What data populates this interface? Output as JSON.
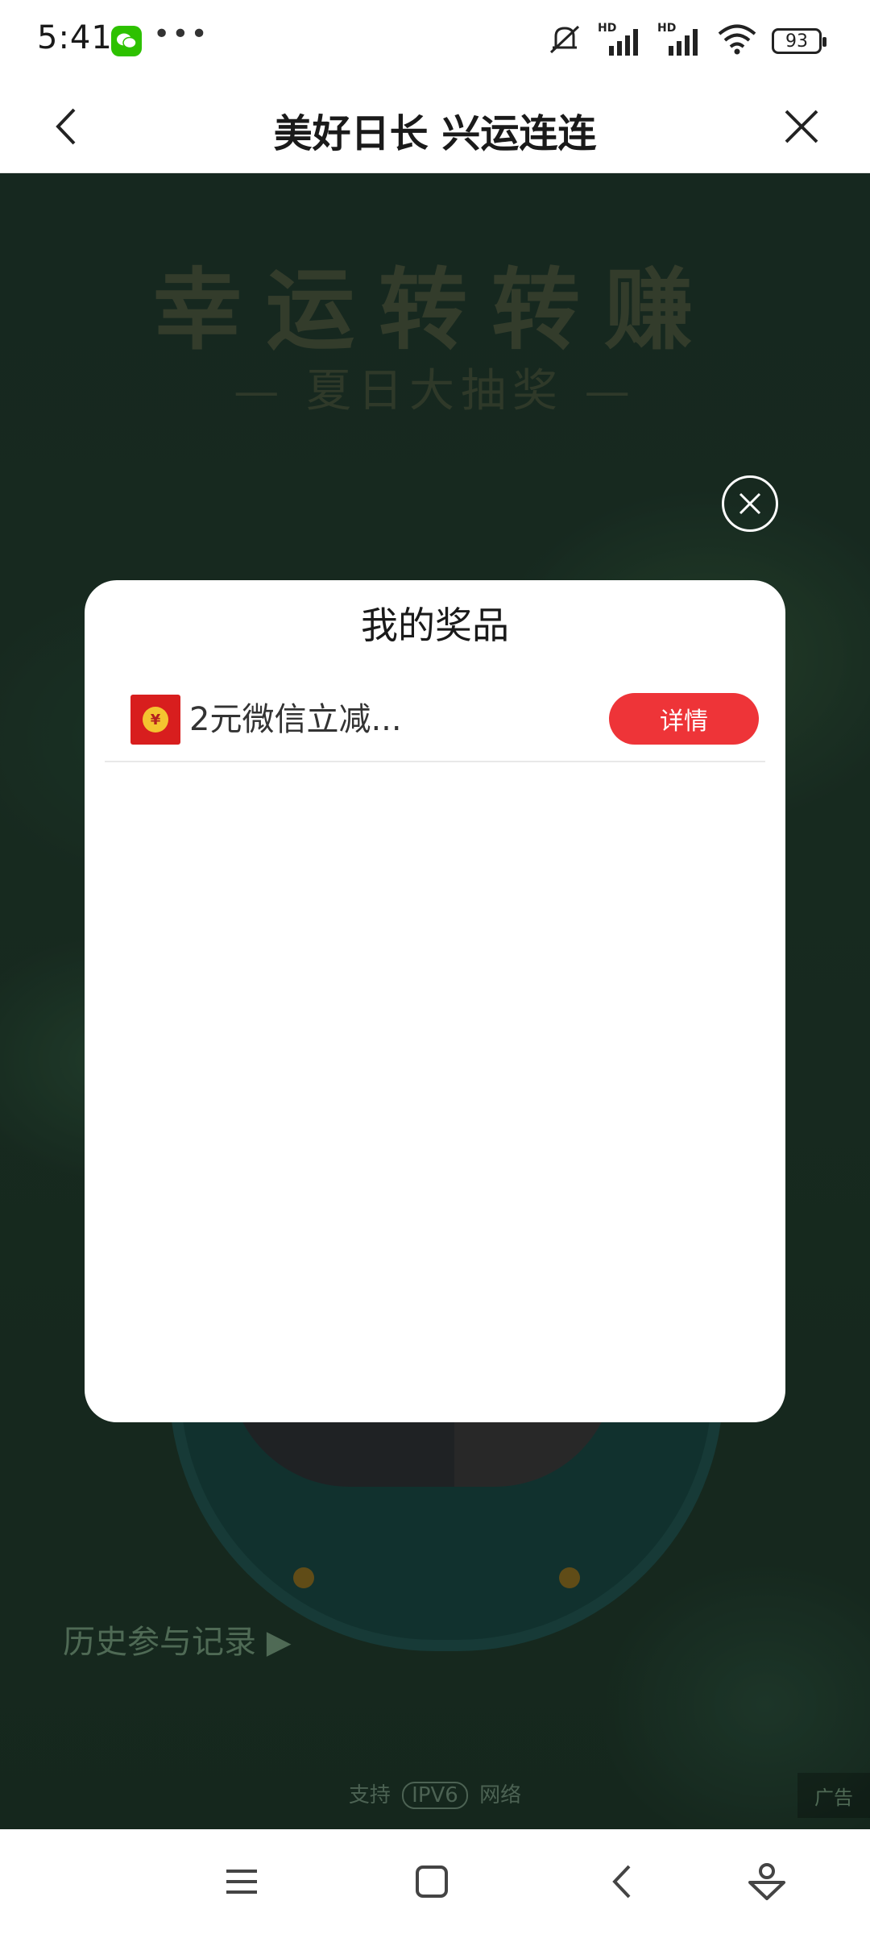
{
  "status_bar": {
    "time": "5:41",
    "dots": "•••",
    "signal_label_1": "HD",
    "signal_label_2": "HD",
    "battery": "93"
  },
  "title_bar": {
    "title": "美好日长 兴运连连"
  },
  "background": {
    "game_title": "幸运转转赚",
    "game_subtitle": "— 夏日大抽奖 —",
    "history_link": "历史参与记录 ▶",
    "ipv6_prefix": "支持",
    "ipv6_tag": "IPV6",
    "ipv6_suffix": "网络",
    "ad_label": "广告"
  },
  "modal": {
    "title": "我的奖品",
    "prizes": [
      {
        "name": "2元微信立减...",
        "button_label": "详情"
      }
    ]
  },
  "colors": {
    "accent_red": "#ee3438",
    "wechat_green": "#2dc100"
  }
}
